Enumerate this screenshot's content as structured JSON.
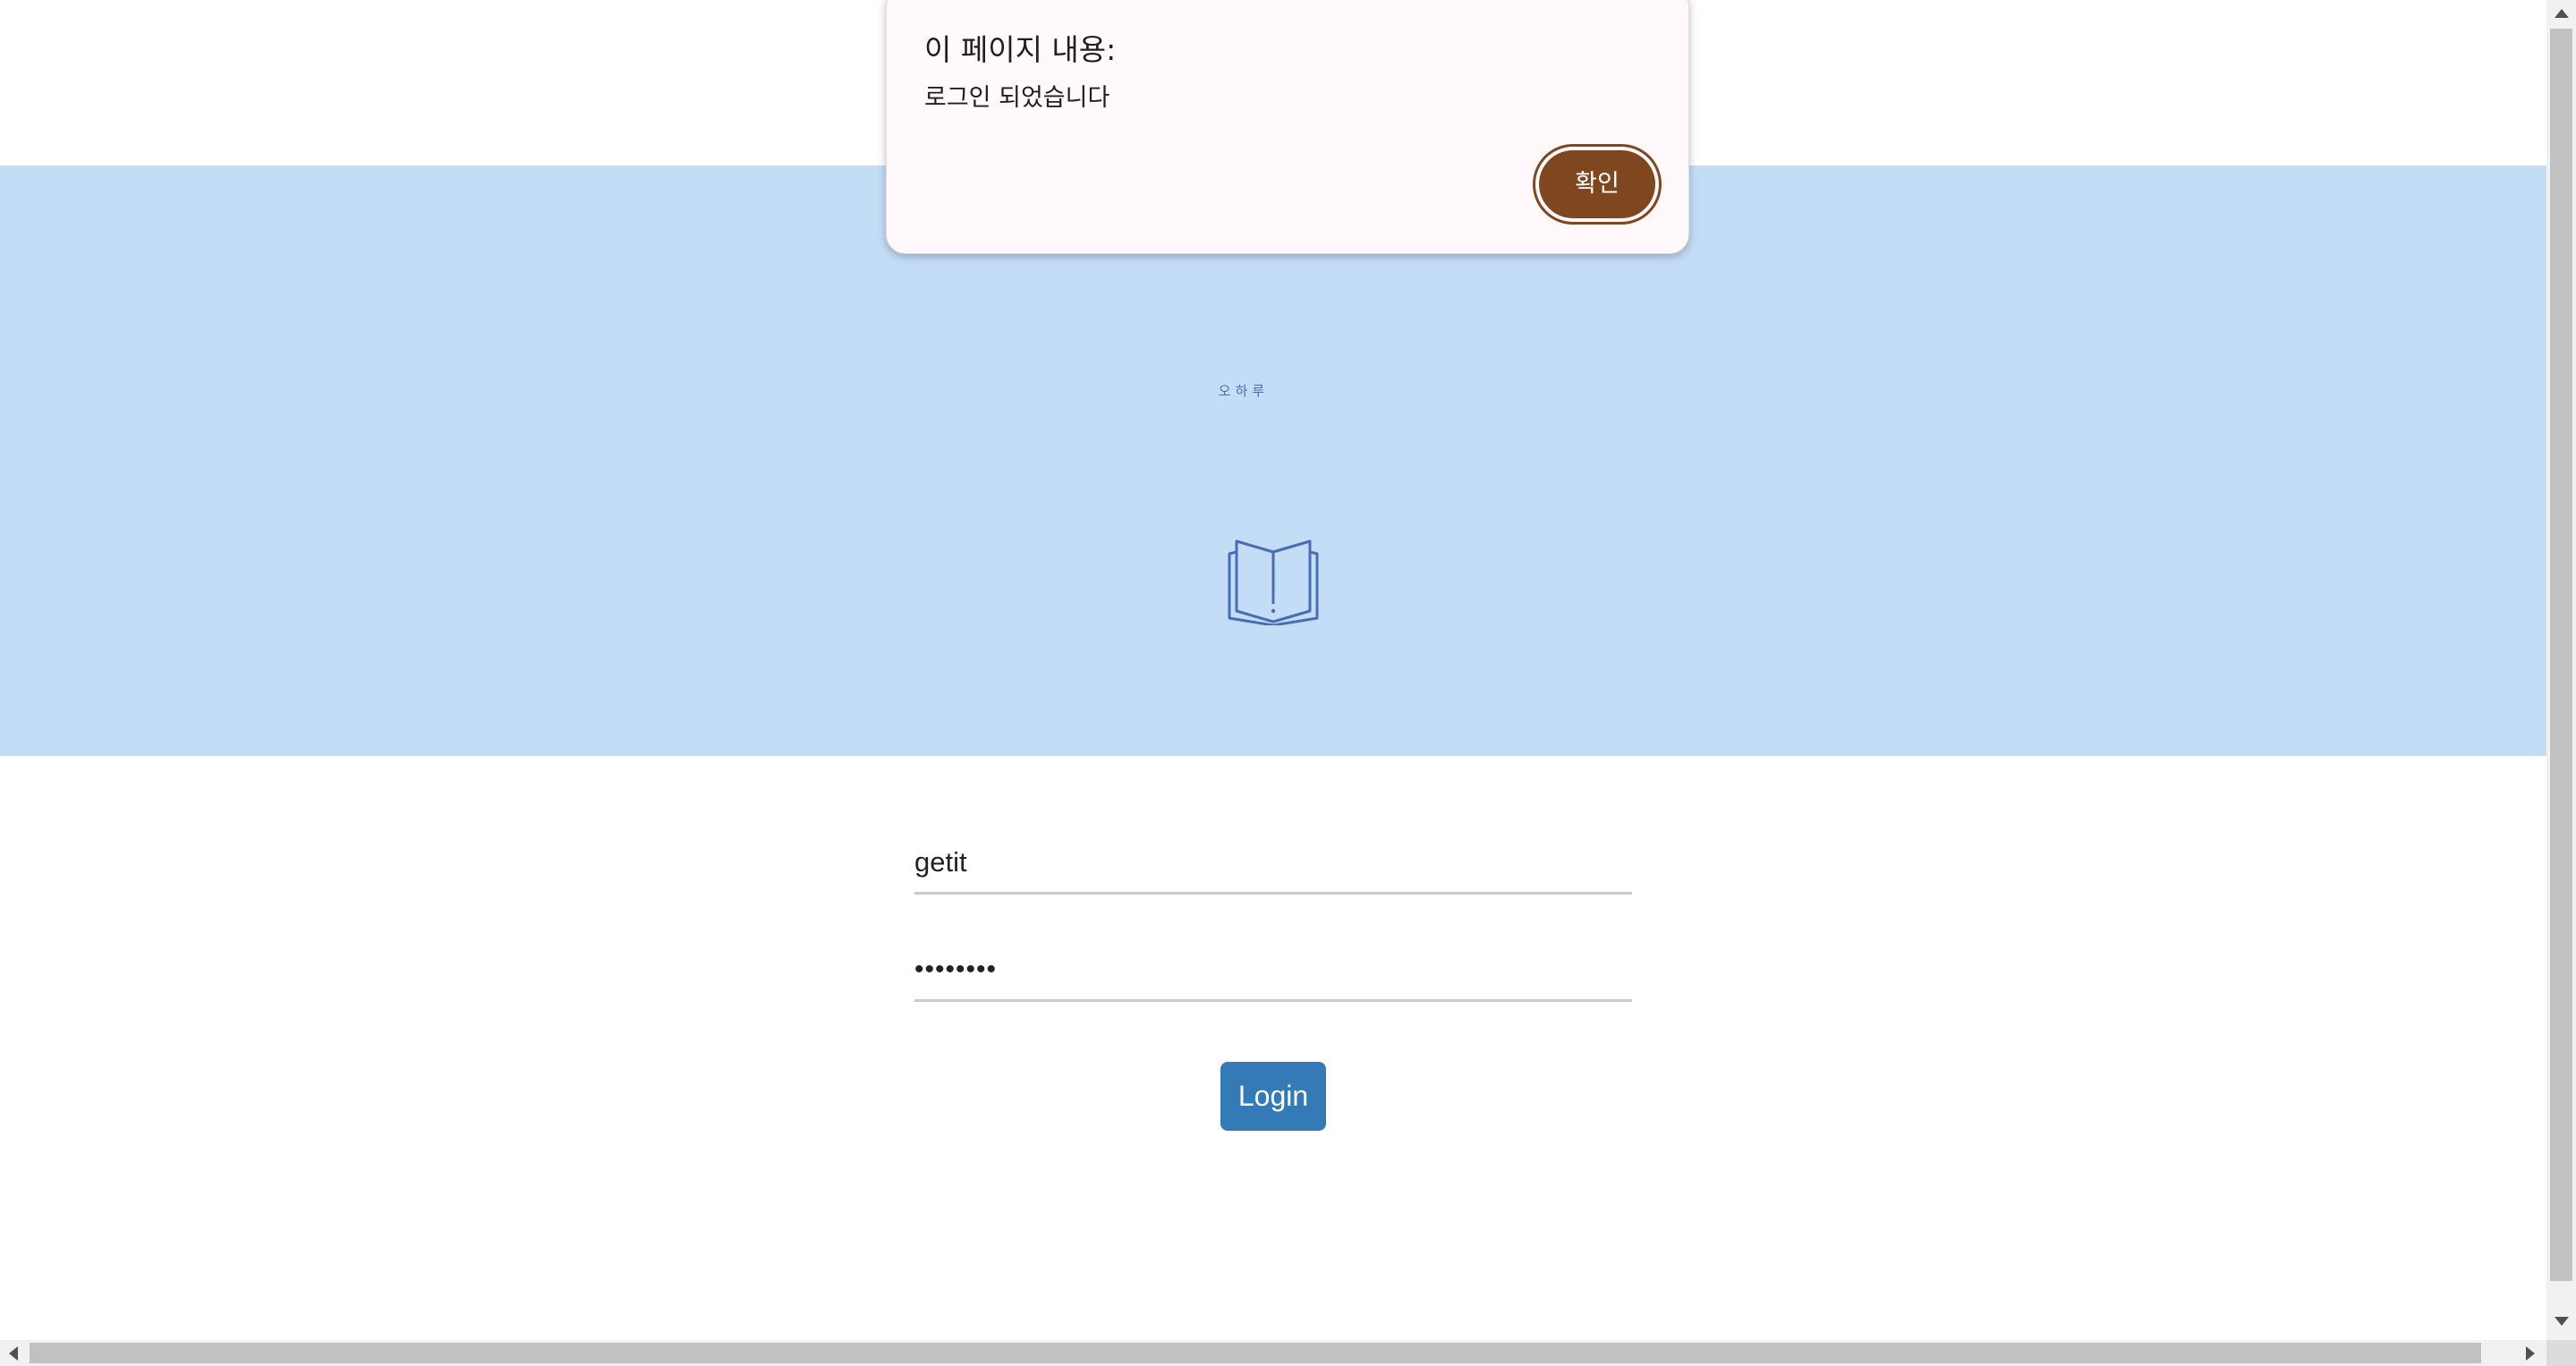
{
  "hero": {
    "subtitle": "오하루",
    "icon": "open-book-icon",
    "background": "#c4ddf6",
    "accent": "#4a6cb6"
  },
  "form": {
    "username_value": "getit",
    "password_value": "••••••••",
    "login_label": "Login",
    "login_color": "#337ab7"
  },
  "dialog": {
    "title": "이 페이지 내용:",
    "message": "로그인 되었습니다",
    "ok_label": "확인",
    "ok_color": "#7f4720"
  },
  "scrollbars": {
    "vertical_icons": [
      "arrow-up-icon",
      "arrow-down-icon"
    ],
    "horizontal_icons": [
      "arrow-left-icon",
      "arrow-right-icon"
    ]
  }
}
